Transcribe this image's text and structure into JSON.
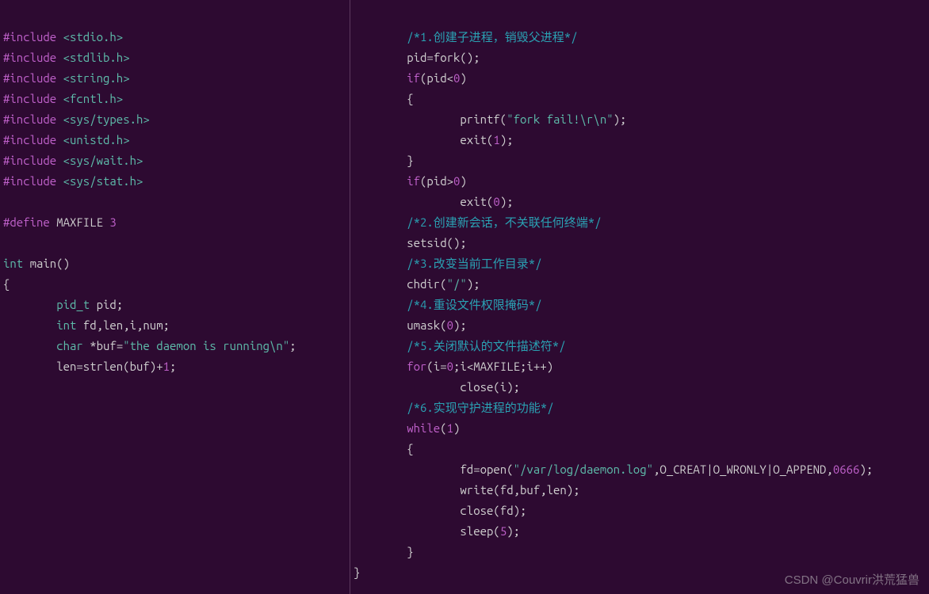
{
  "left": {
    "inc1": "#include ",
    "hdr1": "<stdio.h>",
    "inc2": "#include ",
    "hdr2": "<stdlib.h>",
    "inc3": "#include ",
    "hdr3": "<string.h>",
    "inc4": "#include ",
    "hdr4": "<fcntl.h>",
    "inc5": "#include ",
    "hdr5": "<sys/types.h>",
    "inc6": "#include ",
    "hdr6": "<unistd.h>",
    "inc7": "#include ",
    "hdr7": "<sys/wait.h>",
    "inc8": "#include ",
    "hdr8": "<sys/stat.h>",
    "def_kw": "#define ",
    "def_name": "MAXFILE ",
    "def_val": "3",
    "int_kw": "int",
    "main_name": " main()",
    "brace_open": "{",
    "pid_t": "pid_t",
    "pid_var": " pid;",
    "int_kw2": "int",
    "vars": " fd,len,i,num;",
    "char_kw": "char",
    "buf_decl": " *buf=",
    "buf_str": "\"the daemon is running\\n\"",
    "buf_end": ";",
    "len_line_a": "len=strlen(buf)+",
    "len_line_num": "1",
    "len_line_b": ";"
  },
  "right": {
    "c1": "/*1.创建子进程，销毁父进程*/",
    "l2": "pid=fork();",
    "if_kw": "if",
    "if_cond": "(pid<",
    "zero1": "0",
    "if_cond_end": ")",
    "brace1": "{",
    "printf": "printf(",
    "printf_str": "\"fork fail!\\r\\n\"",
    "printf_end": ");",
    "exit_kw": "exit",
    "exit1_a": "(",
    "exit1_n": "1",
    "exit1_b": ");",
    "brace1c": "}",
    "if2_kw": "if",
    "if2_cond": "(pid>",
    "zero2": "0",
    "if2_cond_end": ")",
    "exit2_a": "exit(",
    "exit2_n": "0",
    "exit2_b": ");",
    "c2": "/*2.创建新会话，不关联任何终端*/",
    "setsid": "setsid();",
    "c3": "/*3.改变当前工作目录*/",
    "chdir_a": "chdir(",
    "chdir_s": "\"/\"",
    "chdir_b": ");",
    "c4": "/*4.重设文件权限掩码*/",
    "umask_a": "umask(",
    "umask_n": "0",
    "umask_b": ");",
    "c5": "/*5.关闭默认的文件描述符*/",
    "for_kw": "for",
    "for_a": "(i=",
    "for_n0": "0",
    "for_b": ";i<MAXFILE;i++)",
    "close_i": "close(i);",
    "c6": "/*6.实现守护进程的功能*/",
    "while_kw": "while",
    "while_a": "(",
    "while_n": "1",
    "while_b": ")",
    "brace2": "{",
    "open_a": "fd=open(",
    "open_s": "\"/var/log/daemon.log\"",
    "open_b": ",O_CREAT|O_WRONLY|O_APPEND,",
    "open_n": "0666",
    "open_c": ");",
    "write_l": "write(fd,buf,len);",
    "close_fd": "close(fd);",
    "sleep_a": "sleep(",
    "sleep_n": "5",
    "sleep_b": ");",
    "brace2c": "}",
    "brace_outer": "}"
  },
  "watermark": "CSDN @Couvrir洪荒猛兽"
}
